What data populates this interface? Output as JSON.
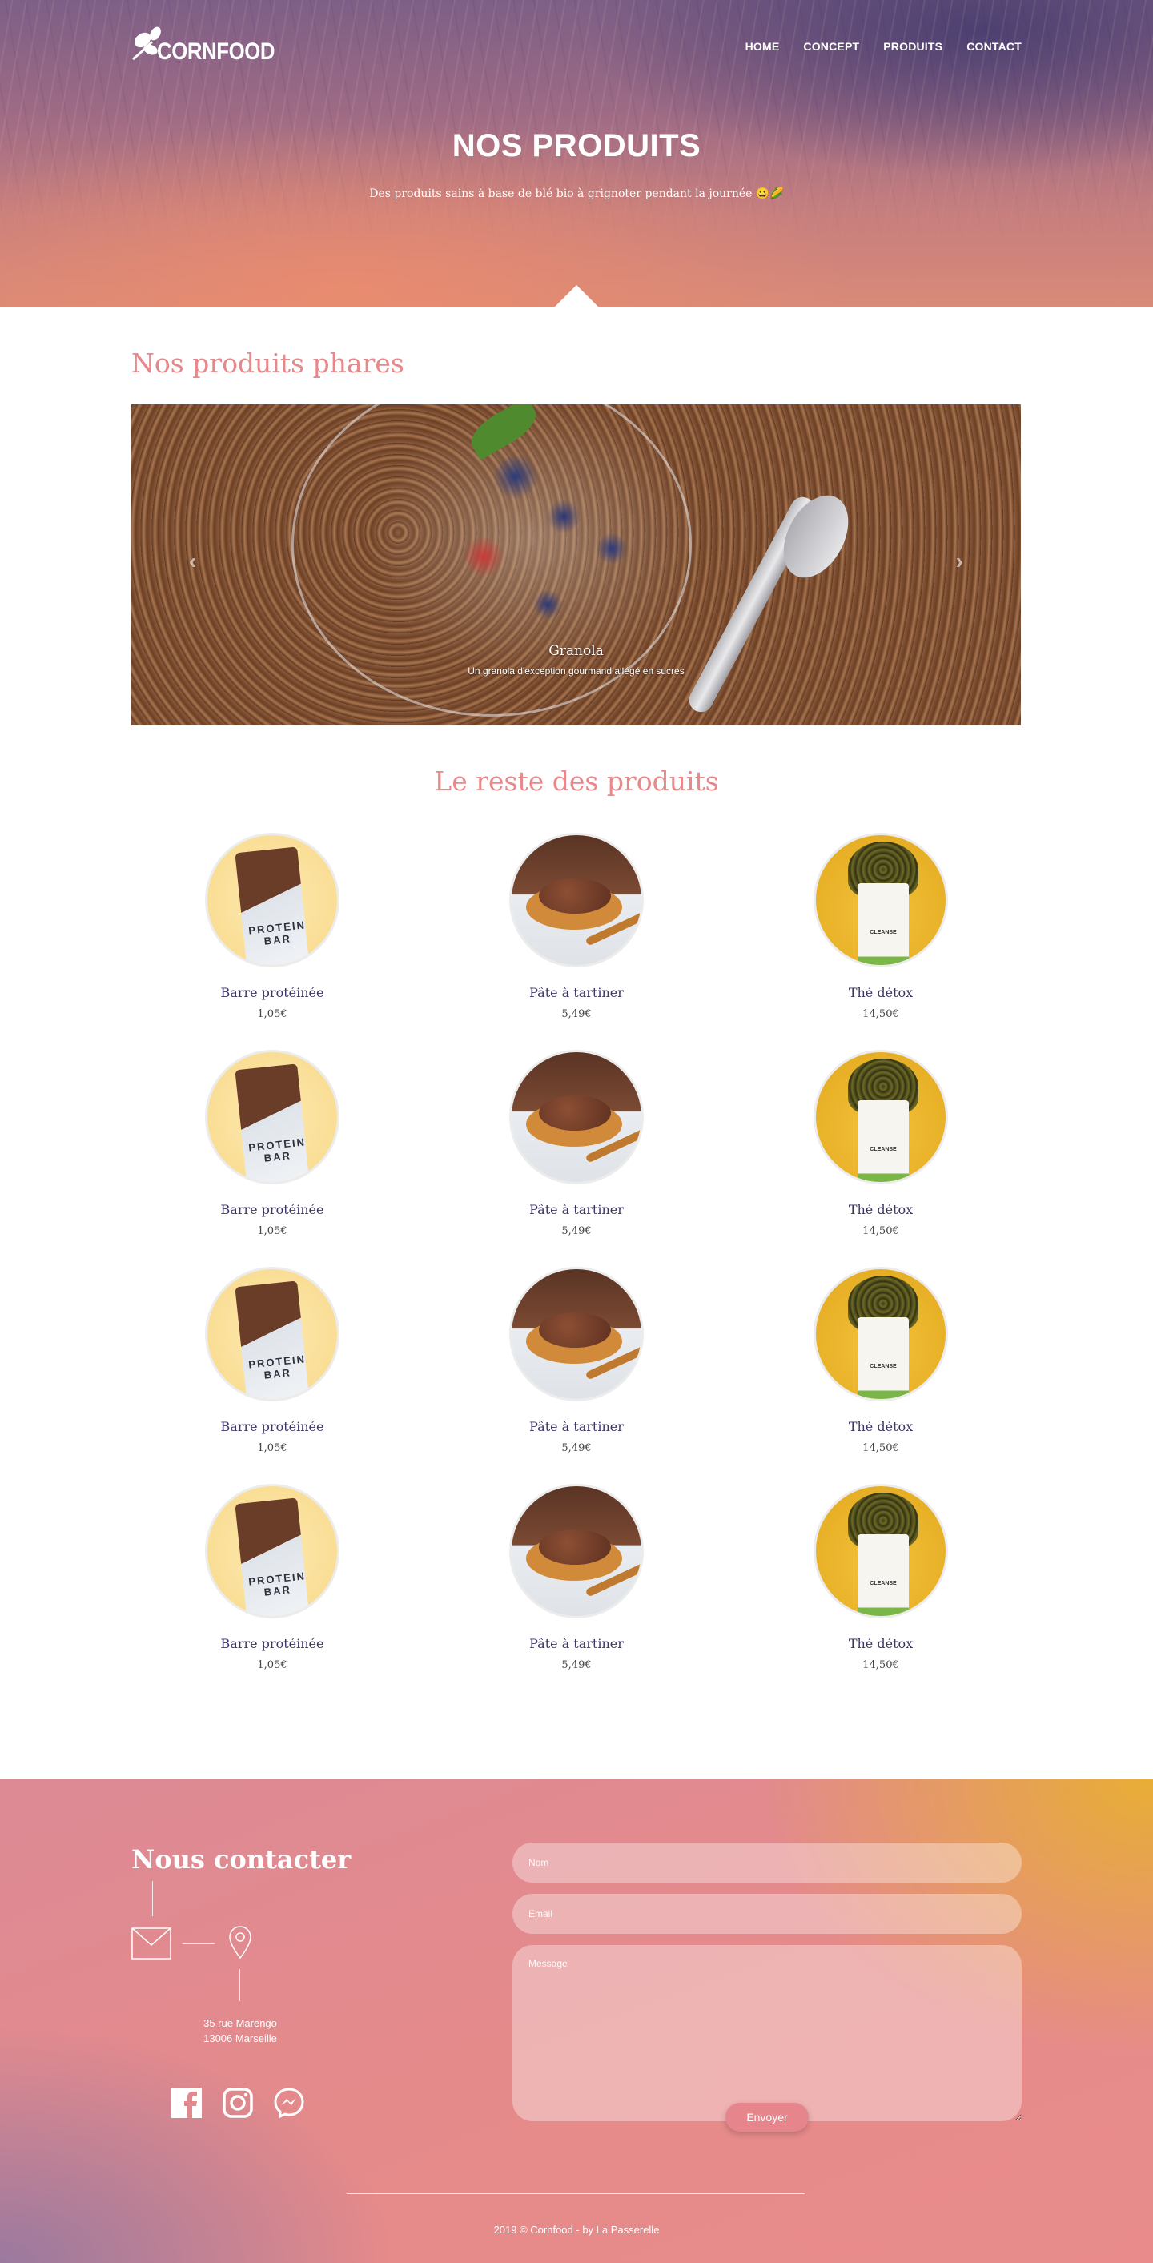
{
  "header": {
    "logo_text": "CORNFOOD",
    "nav": [
      {
        "label": "HOME"
      },
      {
        "label": "CONCEPT"
      },
      {
        "label": "PRODUITS"
      },
      {
        "label": "CONTACT"
      }
    ],
    "title": "NOS PRODUITS",
    "subtitle": "Des produits sains à base de blé bio à grignoter pendant la journée 😀🌽"
  },
  "featured": {
    "title": "Nos produits phares",
    "slide": {
      "title": "Granola",
      "caption": "Un granola d'exception gourmand allégé en sucres"
    },
    "prev_icon": "chevron-left-icon",
    "next_icon": "chevron-right-icon"
  },
  "products": {
    "title": "Le reste des produits",
    "items": [
      {
        "name": "Barre protéinée",
        "price": "1,05€",
        "image": "protein-bar",
        "pack_label": "PROTEIN BAR"
      },
      {
        "name": "Pâte à tartiner",
        "price": "5,49€",
        "image": "chocolate-spread"
      },
      {
        "name": "Thé détox",
        "price": "14,50€",
        "image": "detox-tea",
        "pack_label": "CLEANSE"
      },
      {
        "name": "Barre protéinée",
        "price": "1,05€",
        "image": "protein-bar",
        "pack_label": "PROTEIN BAR"
      },
      {
        "name": "Pâte à tartiner",
        "price": "5,49€",
        "image": "chocolate-spread"
      },
      {
        "name": "Thé détox",
        "price": "14,50€",
        "image": "detox-tea",
        "pack_label": "CLEANSE"
      },
      {
        "name": "Barre protéinée",
        "price": "1,05€",
        "image": "protein-bar",
        "pack_label": "PROTEIN BAR"
      },
      {
        "name": "Pâte à tartiner",
        "price": "5,49€",
        "image": "chocolate-spread"
      },
      {
        "name": "Thé détox",
        "price": "14,50€",
        "image": "detox-tea",
        "pack_label": "CLEANSE"
      },
      {
        "name": "Barre protéinée",
        "price": "1,05€",
        "image": "protein-bar",
        "pack_label": "PROTEIN BAR"
      },
      {
        "name": "Pâte à tartiner",
        "price": "5,49€",
        "image": "chocolate-spread"
      },
      {
        "name": "Thé détox",
        "price": "14,50€",
        "image": "detox-tea",
        "pack_label": "CLEANSE"
      }
    ]
  },
  "contact": {
    "title": "Nous contacter",
    "address_line1": "35 rue Marengo",
    "address_line2": "13006 Marseille",
    "icons": [
      "mail-icon",
      "location-pin-icon"
    ],
    "socials": [
      "facebook-icon",
      "instagram-icon",
      "messenger-icon"
    ],
    "form": {
      "name_placeholder": "Nom",
      "email_placeholder": "Email",
      "message_placeholder": "Message",
      "submit_label": "Envoyer"
    },
    "copyright": "2019 © Cornfood - by La Passerelle"
  },
  "colors": {
    "accent": "#e8888a",
    "product_name": "#3d3566",
    "button": "#e7858c",
    "white": "#ffffff"
  }
}
